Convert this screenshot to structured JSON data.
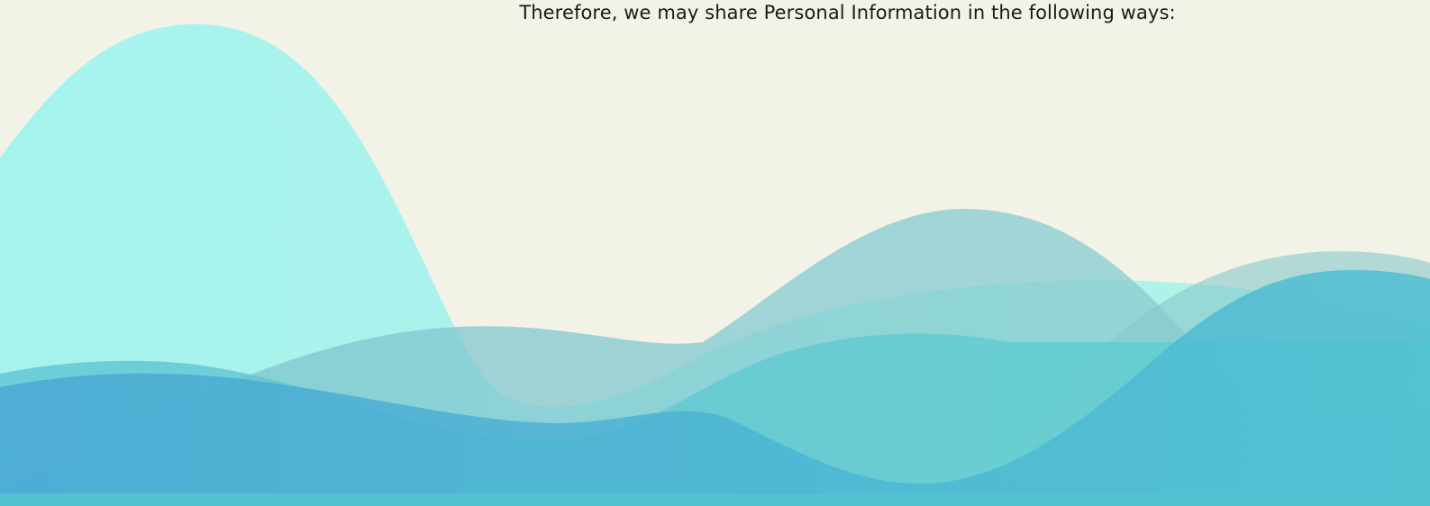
{
  "content": {
    "intro_text": "Therefore, we may share Personal Information in the following ways:"
  },
  "decoration": {
    "background_color": "#f3f2e7",
    "wave_colors": [
      "#a6f1ea",
      "#8fcfd3",
      "#6fd1d6",
      "#5bb8d8",
      "#49aed4"
    ]
  }
}
